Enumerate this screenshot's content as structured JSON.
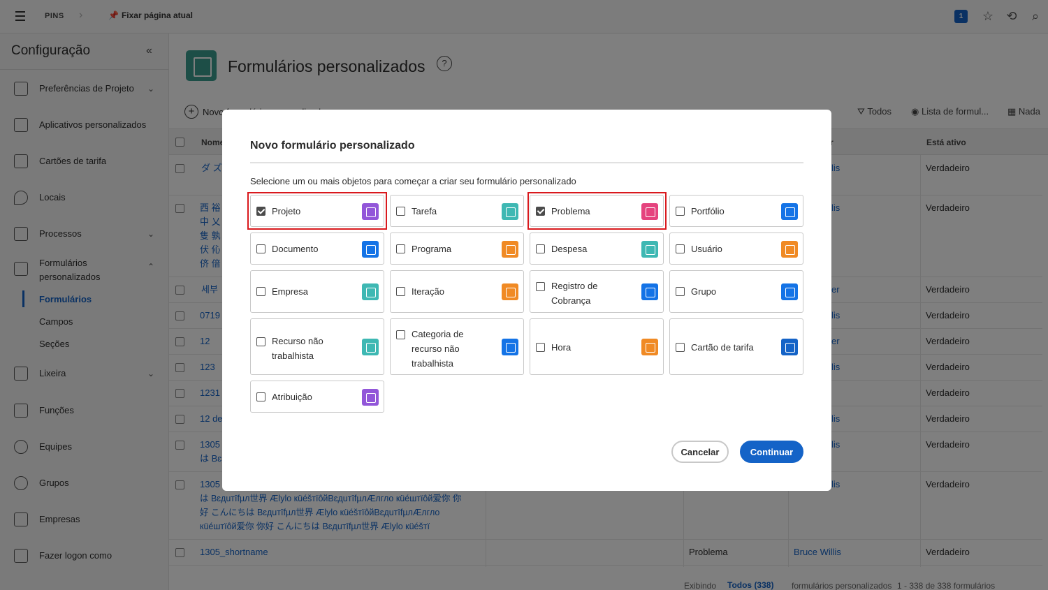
{
  "topbar": {
    "pins": "PINS",
    "pin_page": "Fixar página atual",
    "badge": "1"
  },
  "sidebar": {
    "title": "Configuração",
    "items": [
      {
        "label": "Preferências de Projeto"
      },
      {
        "label": "Aplicativos personalizados"
      },
      {
        "label": "Cartões de tarifa"
      },
      {
        "label": "Locais"
      },
      {
        "label": "Processos"
      },
      {
        "label": "Formulários personalizados"
      },
      {
        "label": "Lixeira"
      },
      {
        "label": "Funções"
      },
      {
        "label": "Equipes"
      },
      {
        "label": "Grupos"
      },
      {
        "label": "Empresas"
      },
      {
        "label": "Fazer logon como"
      }
    ],
    "subitems": [
      "Formulários",
      "Campos",
      "Seções"
    ]
  },
  "main": {
    "title": "Formulários personalizados",
    "help": "?",
    "new_form": "Novo formulário personalizado",
    "filter_all": "Todos",
    "view": "Lista de formul...",
    "group": "Nada",
    "columns": {
      "name": "Nome",
      "is_active": "Está ativo",
      "owner": "r"
    },
    "rows": [
      {
        "name": "ダ ズ",
        "owner": "lis",
        "active": "Verdadeiro"
      },
      {
        "name": "西 裕\n中 乂\n隻 孰\n伏 伈\n侪 偣",
        "owner": "lis",
        "active": "Verdadeiro"
      },
      {
        "name": "세부",
        "owner": "er",
        "active": "Verdadeiro"
      },
      {
        "name": "0719",
        "owner": "lis",
        "active": "Verdadeiro"
      },
      {
        "name": "12",
        "owner": "er",
        "active": "Verdadeiro"
      },
      {
        "name": "123",
        "owner": "lis",
        "active": "Verdadeiro"
      },
      {
        "name": "1231",
        "owner": "t",
        "active": "Verdadeiro"
      },
      {
        "name": "12 de",
        "owner": "lis",
        "active": "Verdadeiro"
      },
      {
        "name": "1305 /\nは Bɛ",
        "owner": "lis",
        "active": "Verdadeiro"
      },
      {
        "name": "1305 /",
        "owner": "lis",
        "active": "Verdadeiro"
      },
      {
        "name": "1305_shortname",
        "type": "Problema",
        "owner": "Bruce Willis",
        "active": "Verdadeiro"
      }
    ],
    "long_text": "は Bɛдuтīfµл世界 Ælуlo кüéšтïôйBɛдuтīfµлÆлгло кüéштïôй爱你 你\n好 こんにちは Bɛдuтīfµл世界 Ælуlo кüéšтïôйBɛдuтīfµлÆлгло\nкüéштïôй爱你 你好 こんにちは Bɛдuтīfµл世界 Ælуlo кüéšтï",
    "footer": {
      "showing": "Exibindo",
      "all": "Todos (338)",
      "label": "formulários personalizados",
      "range": "1 - 338 de 338 formulários personalizados"
    }
  },
  "modal": {
    "title": "Novo formulário personalizado",
    "description": "Selecione um ou mais objetos para começar a criar seu formulário personalizado",
    "options": [
      {
        "label": "Projeto",
        "checked": true,
        "color": "#9256d9"
      },
      {
        "label": "Tarefa",
        "checked": false,
        "color": "#3eb8b3"
      },
      {
        "label": "Problema",
        "checked": true,
        "color": "#e5437e"
      },
      {
        "label": "Portfólio",
        "checked": false,
        "color": "#1473e6"
      },
      {
        "label": "Documento",
        "checked": false,
        "color": "#1473e6"
      },
      {
        "label": "Programa",
        "checked": false,
        "color": "#f08a24"
      },
      {
        "label": "Despesa",
        "checked": false,
        "color": "#3eb8b3"
      },
      {
        "label": "Usuário",
        "checked": false,
        "color": "#f08a24"
      },
      {
        "label": "Empresa",
        "checked": false,
        "color": "#3eb8b3"
      },
      {
        "label": "Iteração",
        "checked": false,
        "color": "#f08a24"
      },
      {
        "label": "Registro de Cobrança",
        "checked": false,
        "color": "#1473e6"
      },
      {
        "label": "Grupo",
        "checked": false,
        "color": "#1473e6"
      },
      {
        "label": "Recurso não trabalhista",
        "checked": false,
        "color": "#3eb8b3"
      },
      {
        "label": "Categoria de recurso não trabalhista",
        "checked": false,
        "color": "#1473e6"
      },
      {
        "label": "Hora",
        "checked": false,
        "color": "#f08a24"
      },
      {
        "label": "Cartão de tarifa",
        "checked": false,
        "color": "#1463c7"
      },
      {
        "label": "Atribuição",
        "checked": false,
        "color": "#9256d9"
      }
    ],
    "cancel": "Cancelar",
    "continue": "Continuar"
  }
}
